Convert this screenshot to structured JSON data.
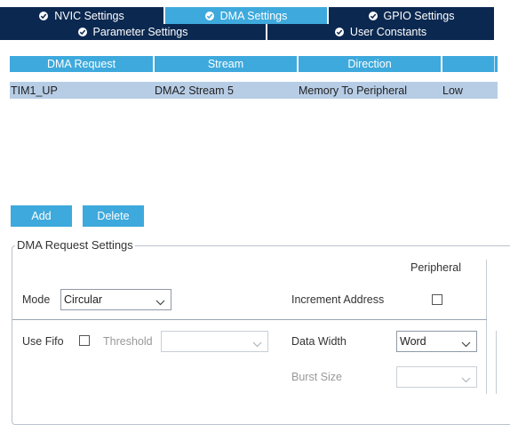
{
  "tabs_row1": [
    {
      "label": "NVIC Settings",
      "active": false
    },
    {
      "label": "DMA Settings",
      "active": true
    },
    {
      "label": "GPIO Settings",
      "active": false
    }
  ],
  "tabs_row2": [
    {
      "label": "Parameter Settings",
      "active": false
    },
    {
      "label": "User Constants",
      "active": false
    }
  ],
  "table": {
    "headers": [
      "DMA Request",
      "Stream",
      "Direction",
      ""
    ],
    "rows": [
      [
        "TIM1_UP",
        "DMA2 Stream 5",
        "Memory To Peripheral",
        "Low"
      ]
    ]
  },
  "buttons": {
    "add": "Add",
    "delete": "Delete"
  },
  "settings": {
    "legend": "DMA Request Settings",
    "peripheral_header": "Peripheral",
    "mode_label": "Mode",
    "mode_value": "Circular",
    "increment_address_label": "Increment Address",
    "increment_address_checked": false,
    "use_fifo_label": "Use Fifo",
    "use_fifo_checked": false,
    "threshold_label": "Threshold",
    "threshold_value": "",
    "data_width_label": "Data Width",
    "data_width_value": "Word",
    "burst_size_label": "Burst Size",
    "burst_size_value": ""
  },
  "colors": {
    "tab_dark": "#0b2850",
    "tab_active": "#3ea9dc",
    "header_blue": "#3ea9dc",
    "row_selected": "#b7cde6",
    "button_blue": "#3ea9dc"
  }
}
